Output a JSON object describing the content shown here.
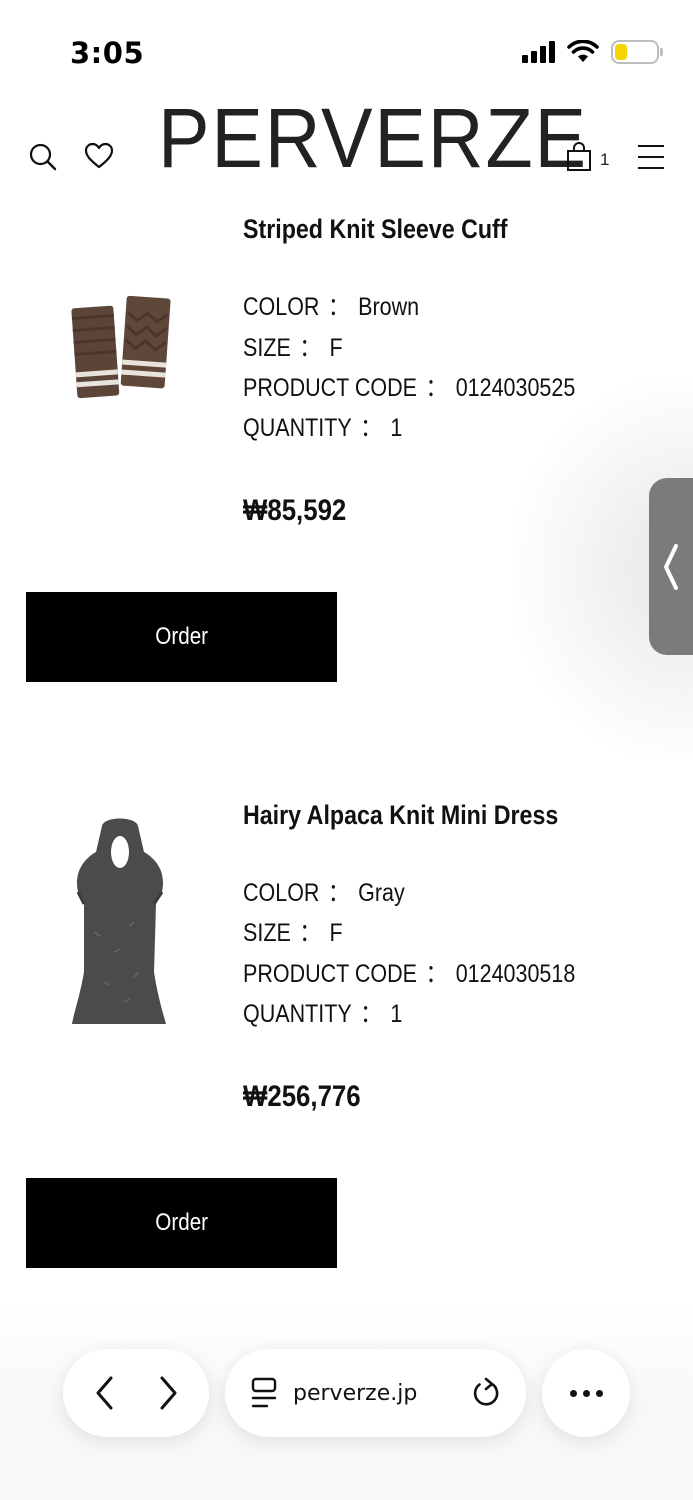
{
  "status_bar": {
    "time": "3:05"
  },
  "header": {
    "logo": "PERVERZE",
    "cart_count": "1",
    "icons": [
      "search-icon",
      "heart-icon",
      "cart-icon",
      "menu-icon"
    ]
  },
  "items": [
    {
      "name": "Striped Knit Sleeve Cuff",
      "color_label": "COLOR",
      "color_value": "Brown",
      "size_label": "SIZE",
      "size_value": "F",
      "code_label": "PRODUCT CODE",
      "code_value": "0124030525",
      "quantity_label": "QUANTITY",
      "quantity_value": "1",
      "price": "₩85,592",
      "order_label": "Order",
      "image_icon": "knit-sleeve-cuff-image"
    },
    {
      "name": "Hairy Alpaca Knit Mini Dress",
      "color_label": "COLOR",
      "color_value": "Gray",
      "size_label": "SIZE",
      "size_value": "F",
      "code_label": "PRODUCT CODE",
      "code_value": "0124030518",
      "quantity_label": "QUANTITY",
      "quantity_value": "1",
      "price": "₩256,776",
      "order_label": "Order",
      "image_icon": "knit-mini-dress-image"
    }
  ],
  "attribute_separator": "：",
  "browser_bar": {
    "url": "perverze.jp",
    "icons": [
      "back-icon",
      "forward-icon",
      "reader-icon",
      "reload-icon",
      "more-icon"
    ]
  },
  "colors": {
    "button_bg": "#000000",
    "button_text": "#ffffff",
    "battery_fill": "#f5d400",
    "side_handle": "#7b7b7b"
  }
}
